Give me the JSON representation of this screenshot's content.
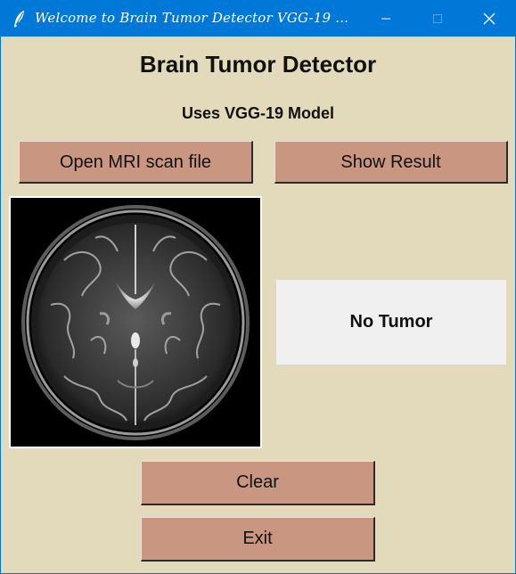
{
  "window": {
    "title": "Welcome to Brain Tumor Detector VGG-19 ..."
  },
  "app": {
    "heading": "Brain Tumor Detector",
    "subheading": "Uses VGG-19 Model"
  },
  "buttons": {
    "open_label": "Open MRI scan file",
    "result_label": "Show Result",
    "clear_label": "Clear",
    "exit_label": "Exit"
  },
  "result": {
    "text": "No Tumor"
  },
  "icons": {
    "app": "feather-icon",
    "minimize": "minimize-icon",
    "maximize": "maximize-icon",
    "close": "close-icon"
  },
  "colors": {
    "titlebar": "#0078d7",
    "background": "#e3d9bb",
    "button": "#c99681",
    "result_panel": "#f0f0f0"
  }
}
